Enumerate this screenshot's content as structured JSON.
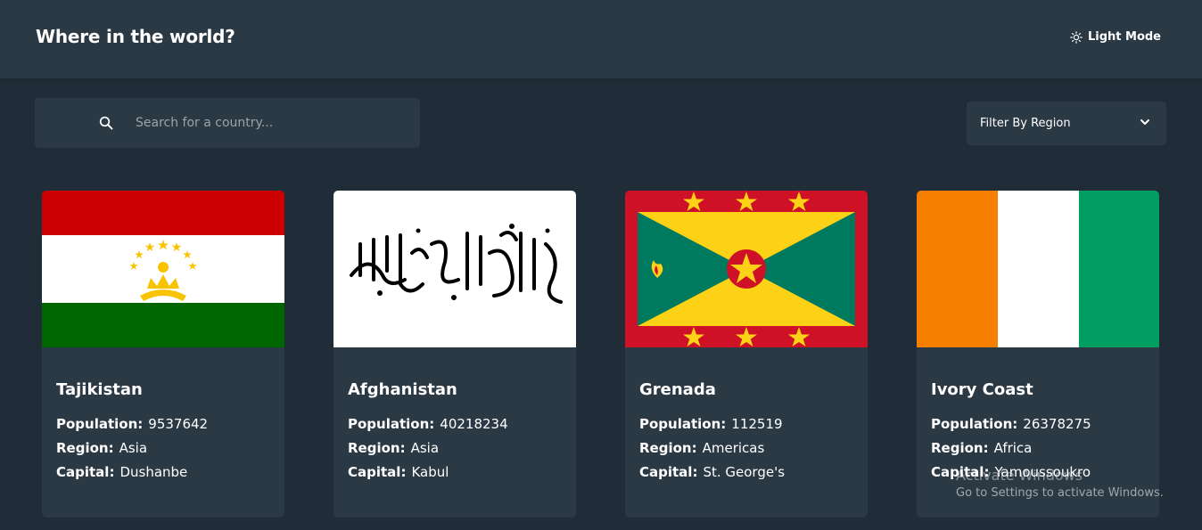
{
  "header": {
    "title": "Where in the world?",
    "theme_toggle_label": "Light Mode",
    "theme_icon": "sun-icon"
  },
  "search": {
    "placeholder": "Search for a country...",
    "value": "",
    "icon": "search-icon"
  },
  "filter": {
    "label": "Filter By Region",
    "icon": "chevron-down-icon"
  },
  "countries": [
    {
      "name": "Tajikistan",
      "population": "9537642",
      "region": "Asia",
      "capital": "Dushanbe"
    },
    {
      "name": "Afghanistan",
      "population": "40218234",
      "region": "Asia",
      "capital": "Kabul"
    },
    {
      "name": "Grenada",
      "population": "112519",
      "region": "Americas",
      "capital": "St. George's"
    },
    {
      "name": "Ivory Coast",
      "population": "26378275",
      "region": "Africa",
      "capital": "Yamoussoukro"
    }
  ],
  "labels": {
    "population": "Population:",
    "region": "Region:",
    "capital": "Capital:"
  },
  "watermark": {
    "title": "Activate Windows",
    "subtitle": "Go to Settings to activate Windows."
  },
  "colors": {
    "background": "#202c37",
    "element": "#2b3945",
    "text": "#ffffff"
  }
}
